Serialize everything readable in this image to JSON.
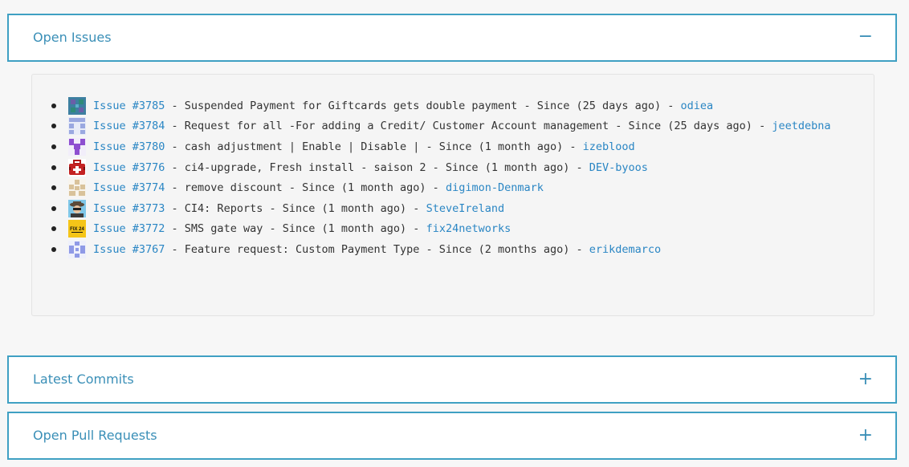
{
  "panels": {
    "issues": {
      "title": "Open Issues",
      "toggle": "−"
    },
    "commits": {
      "title": "Latest Commits",
      "toggle": "+"
    },
    "pulls": {
      "title": "Open Pull Requests",
      "toggle": "+"
    }
  },
  "separator": " - ",
  "issues": [
    {
      "link": "Issue #3785",
      "title": "Suspended Payment for Giftcards gets double payment",
      "since": "Since (25 days ago)",
      "user": "odiea"
    },
    {
      "link": "Issue #3784",
      "title": "Request for all -For adding a Credit/ Customer Account management ",
      "since": "Since (25 days ago)",
      "user": "jeetdebna"
    },
    {
      "link": "Issue #3780",
      "title": "cash adjustment  | Enable | Disable |",
      "since": "Since (1 month ago)",
      "user": "izeblood"
    },
    {
      "link": "Issue #3776",
      "title": " ci4-upgrade, Fresh install - saison 2",
      "since": "Since (1 month ago)",
      "user": "DEV-byoos"
    },
    {
      "link": "Issue #3774",
      "title": "remove discount ",
      "since": "Since (1 month ago)",
      "user": "digimon-Denmark"
    },
    {
      "link": "Issue #3773",
      "title": "CI4: Reports",
      "since": "Since (1 month ago)",
      "user": "SteveIreland"
    },
    {
      "link": "Issue #3772",
      "title": "SMS gate way",
      "since": "Since (1 month ago)",
      "user": "fix24networks"
    },
    {
      "link": "Issue #3767",
      "title": "Feature request: Custom Payment Type",
      "since": "Since (2 months ago)",
      "user": "erikdemarco"
    }
  ],
  "avatars": [
    "odiea-avatar-icon",
    "jeetdebna-avatar-icon",
    "izeblood-avatar-icon",
    "dev-byoos-avatar-icon",
    "digimon-denmark-avatar-icon",
    "steveireland-avatar-icon",
    "fix24networks-avatar-icon",
    "erikdemarco-avatar-icon"
  ],
  "fix24_logo_text": "FIX 24",
  "colors": {
    "accent": "#3fa0c3",
    "link": "#2a86c4",
    "title": "#3a8fb7"
  }
}
